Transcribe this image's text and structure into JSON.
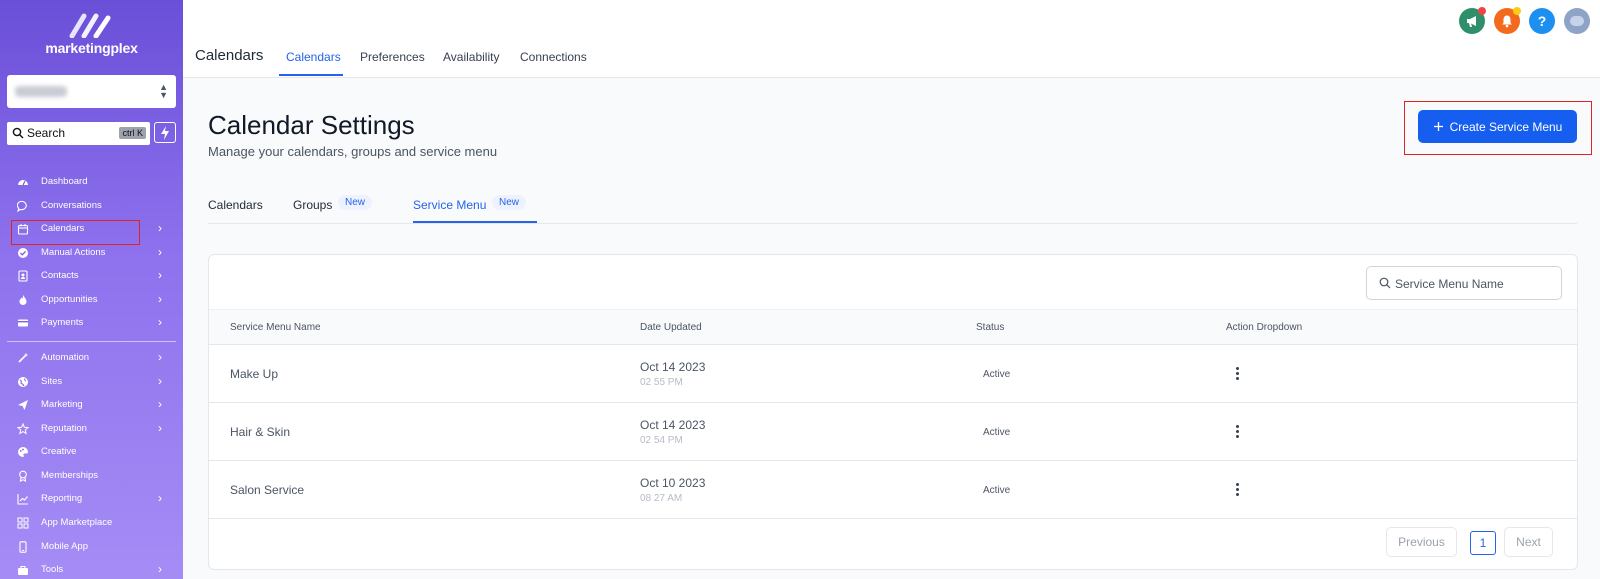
{
  "brand": {
    "name": "marketingplex"
  },
  "sidebar": {
    "search": {
      "label": "Search",
      "shortcut": "ctrl K"
    },
    "items": [
      {
        "label": "Dashboard",
        "icon": "dashboard-icon",
        "chevron": false
      },
      {
        "label": "Conversations",
        "icon": "chat-icon",
        "chevron": false
      },
      {
        "label": "Calendars",
        "icon": "calendar-icon",
        "chevron": true
      },
      {
        "label": "Manual Actions",
        "icon": "check-circle-icon",
        "chevron": true
      },
      {
        "label": "Contacts",
        "icon": "contacts-icon",
        "chevron": true
      },
      {
        "label": "Opportunities",
        "icon": "fire-icon",
        "chevron": true
      },
      {
        "label": "Payments",
        "icon": "card-icon",
        "chevron": true
      },
      {
        "label": "Automation",
        "icon": "wand-icon",
        "chevron": true
      },
      {
        "label": "Sites",
        "icon": "globe-icon",
        "chevron": true
      },
      {
        "label": "Marketing",
        "icon": "send-icon",
        "chevron": true
      },
      {
        "label": "Reputation",
        "icon": "star-icon",
        "chevron": true
      },
      {
        "label": "Creative",
        "icon": "palette-icon",
        "chevron": false
      },
      {
        "label": "Memberships",
        "icon": "badge-icon",
        "chevron": false
      },
      {
        "label": "Reporting",
        "icon": "chart-icon",
        "chevron": true
      },
      {
        "label": "App Marketplace",
        "icon": "grid-icon",
        "chevron": false
      },
      {
        "label": "Mobile App",
        "icon": "phone-icon",
        "chevron": false
      },
      {
        "label": "Tools",
        "icon": "toolbox-icon",
        "chevron": true
      }
    ]
  },
  "topbar": {
    "title": "Calendars",
    "tabs": [
      "Calendars",
      "Preferences",
      "Availability",
      "Connections"
    ],
    "active_tab": "Calendars",
    "icons": [
      "megaphone-icon",
      "bell-icon",
      "help-icon",
      "avatar"
    ],
    "help_glyph": "?"
  },
  "main": {
    "title": "Calendar Settings",
    "subtitle": "Manage your calendars, groups and service menu",
    "create_button": "Create Service Menu",
    "tabs": [
      {
        "label": "Calendars",
        "badge": ""
      },
      {
        "label": "Groups",
        "badge": "New"
      },
      {
        "label": "Service Menu",
        "badge": "New"
      }
    ],
    "active_tab": "Service Menu",
    "search_placeholder": "Service Menu Name",
    "columns": [
      "Service Menu Name",
      "Date Updated",
      "Status",
      "Action Dropdown"
    ],
    "rows": [
      {
        "name": "Make Up",
        "date": "Oct 14 2023",
        "time": "02 55 PM",
        "status": "Active"
      },
      {
        "name": "Hair & Skin",
        "date": "Oct 14 2023",
        "time": "02 54 PM",
        "status": "Active"
      },
      {
        "name": "Salon Service",
        "date": "Oct 10 2023",
        "time": "08 27 AM",
        "status": "Active"
      }
    ],
    "pagination": {
      "previous": "Previous",
      "page": "1",
      "next": "Next"
    }
  },
  "colors": {
    "accent": "#155eef",
    "sidebar_top": "#6a4fd8",
    "sidebar_bottom": "#a58cf5",
    "highlight": "#e02424",
    "megaphone_bg": "#2f8f6b",
    "bell_bg": "#f26b1d",
    "help_bg": "#1c8ff0"
  }
}
